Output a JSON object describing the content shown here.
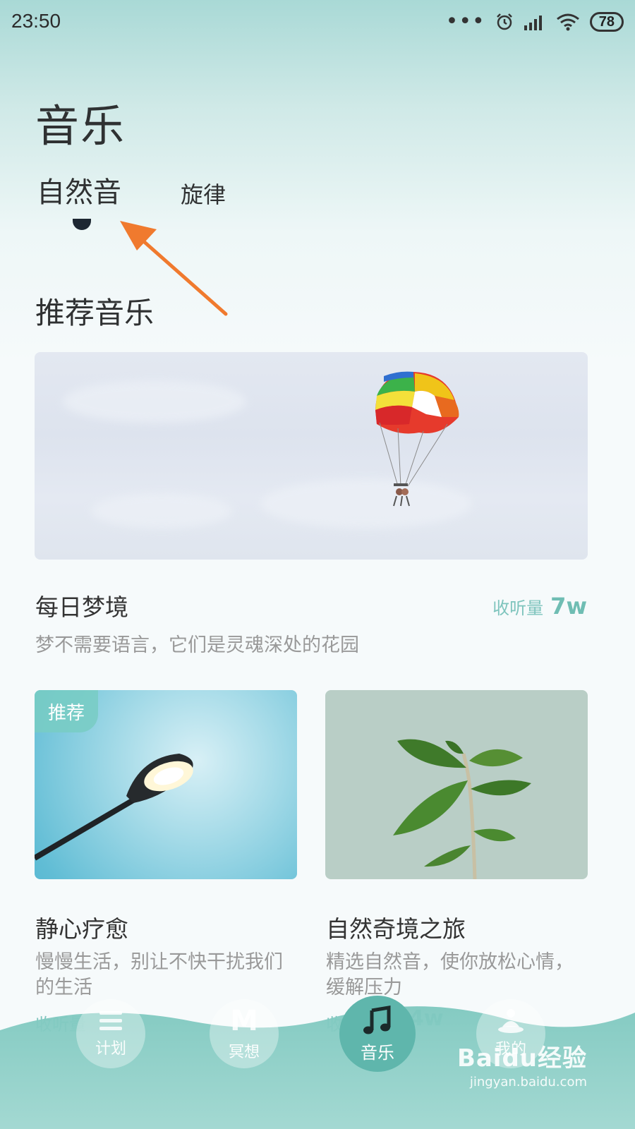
{
  "status_bar": {
    "time": "23:50",
    "battery": "78",
    "icons": [
      "more-dots-icon",
      "alarm-icon",
      "signal-icon",
      "wifi-icon",
      "battery-icon"
    ]
  },
  "page_title": "音乐",
  "tabs": [
    {
      "label": "自然音",
      "active": true
    },
    {
      "label": "旋律",
      "active": false
    }
  ],
  "section_title": "推荐音乐",
  "hero": {
    "title": "每日梦境",
    "listens_label": "收听量",
    "listens_value": "7w",
    "subtitle": "梦不需要语言，它们是灵魂深处的花园"
  },
  "cards": [
    {
      "badge": "推荐",
      "title": "静心疗愈",
      "subtitle": "慢慢生活，别让不快干扰我们的生活",
      "listens_label": "收听量"
    },
    {
      "title": "自然奇境之旅",
      "subtitle": "精选自然音，使你放松心情，缓解压力",
      "listens_label": "收",
      "listens_value": "4w"
    }
  ],
  "nav": [
    {
      "label": "计划",
      "icon": "menu-lines-icon",
      "active": false
    },
    {
      "label": "冥想",
      "icon": "m-letter-icon",
      "active": false
    },
    {
      "label": "音乐",
      "icon": "music-note-icon",
      "active": true
    },
    {
      "label": "我的",
      "icon": "meditation-person-icon",
      "active": false
    }
  ],
  "watermark": {
    "brand": "Baidu经验",
    "url": "jingyan.baidu.com"
  },
  "colors": {
    "accent": "#6fbdb3",
    "title_text": "#2f3132",
    "muted_text": "#999999",
    "arrow": "#f07a2e"
  }
}
